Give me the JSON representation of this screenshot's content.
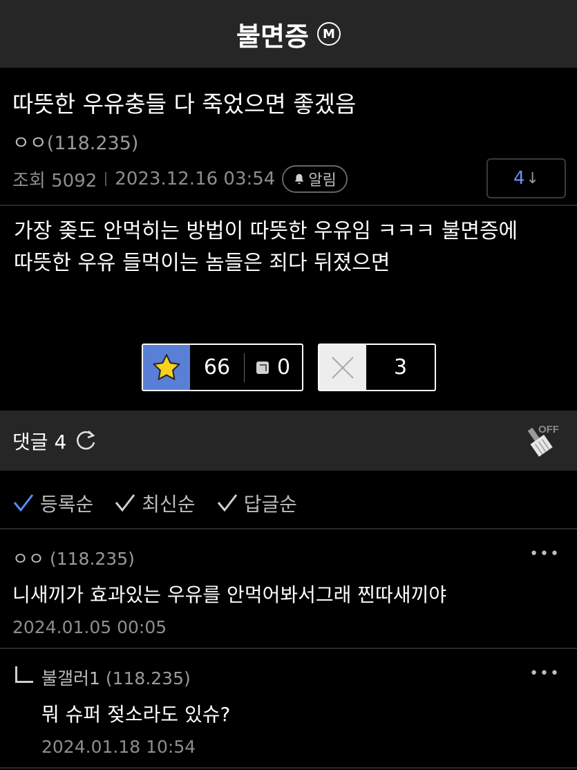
{
  "header": {
    "title": "불면증",
    "minor_badge": "M"
  },
  "post": {
    "title": "따뜻한 우유충들 다 죽었으면 좋겠음",
    "author": "ㅇㅇ",
    "author_ip": "(118.235)",
    "views_label": "조회 5092",
    "datetime": "2023.12.16 03:54",
    "alarm_label": "알림",
    "comment_jump_count": "4",
    "comment_jump_arrow": "↓",
    "body_line1": "가장 좆도 안먹히는 방법이 따뜻한 우유임 ㅋㅋㅋ 불면증에",
    "body_line2": "따뜻한 우유 들먹이는 놈들은 죄다 뒤졌으면"
  },
  "votes": {
    "recommend": "66",
    "fixed_recommend": "0",
    "non_recommend": "3"
  },
  "comments_bar": {
    "label": "댓글",
    "count": "4"
  },
  "sort": {
    "options": [
      "등록순",
      "최신순",
      "답글순"
    ],
    "active_color": "#5b8bf5"
  },
  "comments": [
    {
      "author": "ㅇㅇ",
      "ip": "(118.235)",
      "text": "니새끼가 효과있는 우유를 안먹어봐서그래 찐따새끼야",
      "date": "2024.01.05 00:05",
      "more": "•••"
    },
    {
      "author": "불갤러1",
      "ip": "(118.235)",
      "text": "뭐 슈퍼 젖소라도 있슈?",
      "date": "2024.01.18 10:54",
      "more": "•••"
    }
  ],
  "clean_toggle_label": "OFF"
}
